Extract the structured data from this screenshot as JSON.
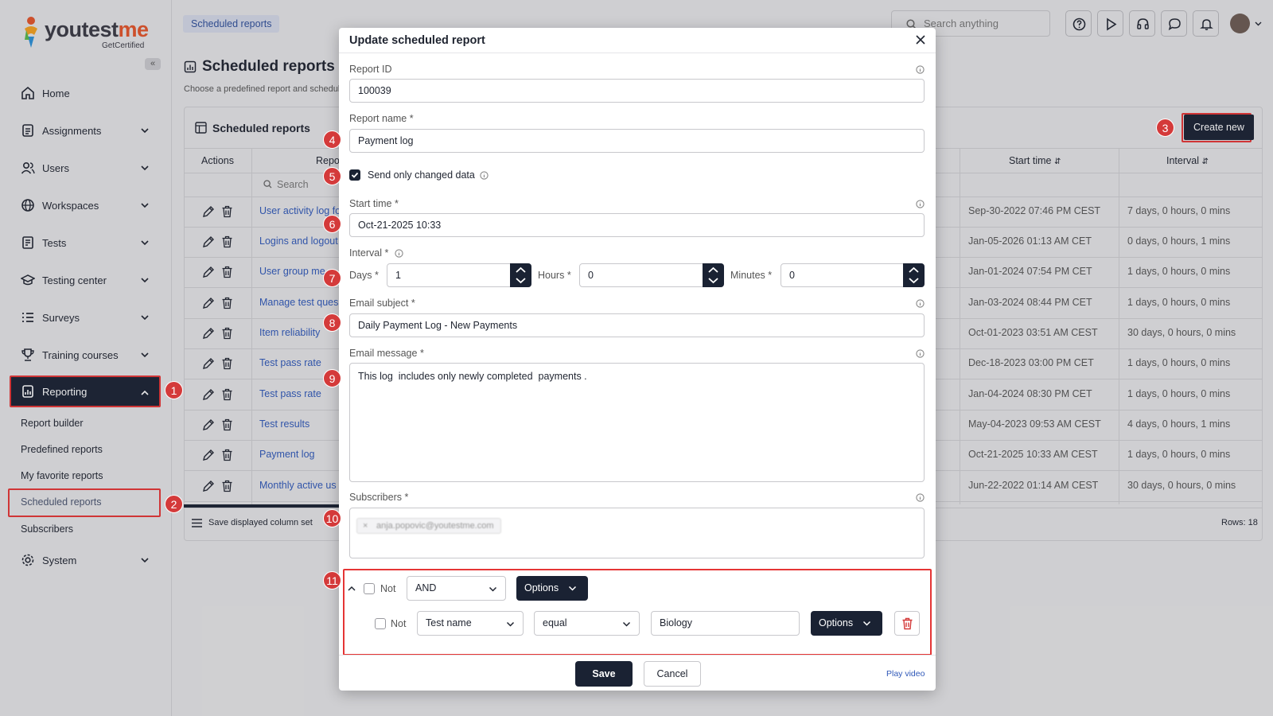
{
  "app": {
    "logo_main": "youtestme",
    "logo_accent": "me",
    "logo_sub": "GetCertified"
  },
  "sidebar": {
    "items": [
      {
        "label": "Home",
        "icon": "home-icon"
      },
      {
        "label": "Assignments",
        "icon": "assignments-icon"
      },
      {
        "label": "Users",
        "icon": "users-icon"
      },
      {
        "label": "Workspaces",
        "icon": "globe-icon"
      },
      {
        "label": "Tests",
        "icon": "tests-icon"
      },
      {
        "label": "Testing center",
        "icon": "testing-center-icon"
      },
      {
        "label": "Surveys",
        "icon": "surveys-icon"
      },
      {
        "label": "Training courses",
        "icon": "trophy-icon"
      },
      {
        "label": "Reporting",
        "icon": "reporting-icon"
      },
      {
        "label": "System",
        "icon": "gear-icon"
      }
    ],
    "sub_items": [
      "Report builder",
      "Predefined reports",
      "My favorite reports",
      "Scheduled reports",
      "Subscribers"
    ]
  },
  "topbar": {
    "breadcrumb": "Scheduled reports",
    "search_placeholder": "Search anything"
  },
  "page": {
    "title": "Scheduled reports",
    "description": "Choose a predefined report and schedule"
  },
  "card": {
    "title": "Scheduled reports",
    "create_new": "Create new",
    "columns": {
      "actions": "Actions",
      "report": "Repo",
      "start_time": "Start time",
      "interval": "Interval"
    },
    "search_placeholder": "Search",
    "rows": [
      {
        "name": "User activity log fo",
        "start": "Sep-30-2022 07:46 PM CEST",
        "interval": "7 days, 0 hours, 0 mins"
      },
      {
        "name": "Logins and logout",
        "start": "Jan-05-2026 01:13 AM CET",
        "interval": "0 days, 0 hours, 1 mins"
      },
      {
        "name": "User group me",
        "start": "Jan-01-2024 07:54 PM CET",
        "interval": "1 days, 0 hours, 0 mins"
      },
      {
        "name": "Manage test ques",
        "start": "Jan-03-2024 08:44 PM CET",
        "interval": "1 days, 0 hours, 0 mins"
      },
      {
        "name": "Item reliability",
        "start": "Oct-01-2023 03:51 AM CEST",
        "interval": "30 days, 0 hours, 0 mins"
      },
      {
        "name": "Test pass rate",
        "start": "Dec-18-2023 03:00 PM CET",
        "interval": "1 days, 0 hours, 0 mins"
      },
      {
        "name": "Test pass rate",
        "start": "Jan-04-2024 08:30 PM CET",
        "interval": "1 days, 0 hours, 0 mins"
      },
      {
        "name": "Test results",
        "start": "May-04-2023 09:53 AM CEST",
        "interval": "4 days, 0 hours, 1 mins"
      },
      {
        "name": "Payment log",
        "start": "Oct-21-2025 10:33 AM CEST",
        "interval": "1 days, 0 hours, 0 mins"
      },
      {
        "name": "Monthly active us",
        "start": "Jun-22-2022 01:14 AM CEST",
        "interval": "30 days, 0 hours, 0 mins"
      }
    ],
    "footer": "Save displayed column set",
    "rows_count": "Rows: 18"
  },
  "modal": {
    "title": "Update scheduled report",
    "report_id_label": "Report ID",
    "report_id": "100039",
    "report_name_label": "Report name",
    "report_name": "Payment log",
    "send_changed_label": "Send only changed data",
    "start_time_label": "Start time",
    "start_time": "Oct-21-2025 10:33",
    "interval_label": "Interval",
    "days_label": "Days",
    "days": "1",
    "hours_label": "Hours",
    "hours": "0",
    "minutes_label": "Minutes",
    "minutes": "0",
    "email_subject_label": "Email subject",
    "email_subject": "Daily Payment Log - New Payments",
    "email_message_label": "Email message",
    "email_message": "This log  includes only newly completed  payments .",
    "subscribers_label": "Subscribers",
    "subscriber_chip": "anja.popovic@youtestme.com",
    "not_label": "Not",
    "logic_value": "AND",
    "options_label": "Options",
    "filter_field": "Test name",
    "filter_op": "equal",
    "filter_value": "Biology",
    "save": "Save",
    "cancel": "Cancel",
    "play_video": "Play video",
    "required_mark": "*"
  },
  "badges": [
    "1",
    "2",
    "3",
    "4",
    "5",
    "6",
    "7",
    "8",
    "9",
    "10",
    "11"
  ],
  "colors": {
    "navy": "#1a2233",
    "link": "#2f58b8",
    "highlight": "#e53535",
    "badge": "#d43a3a"
  }
}
